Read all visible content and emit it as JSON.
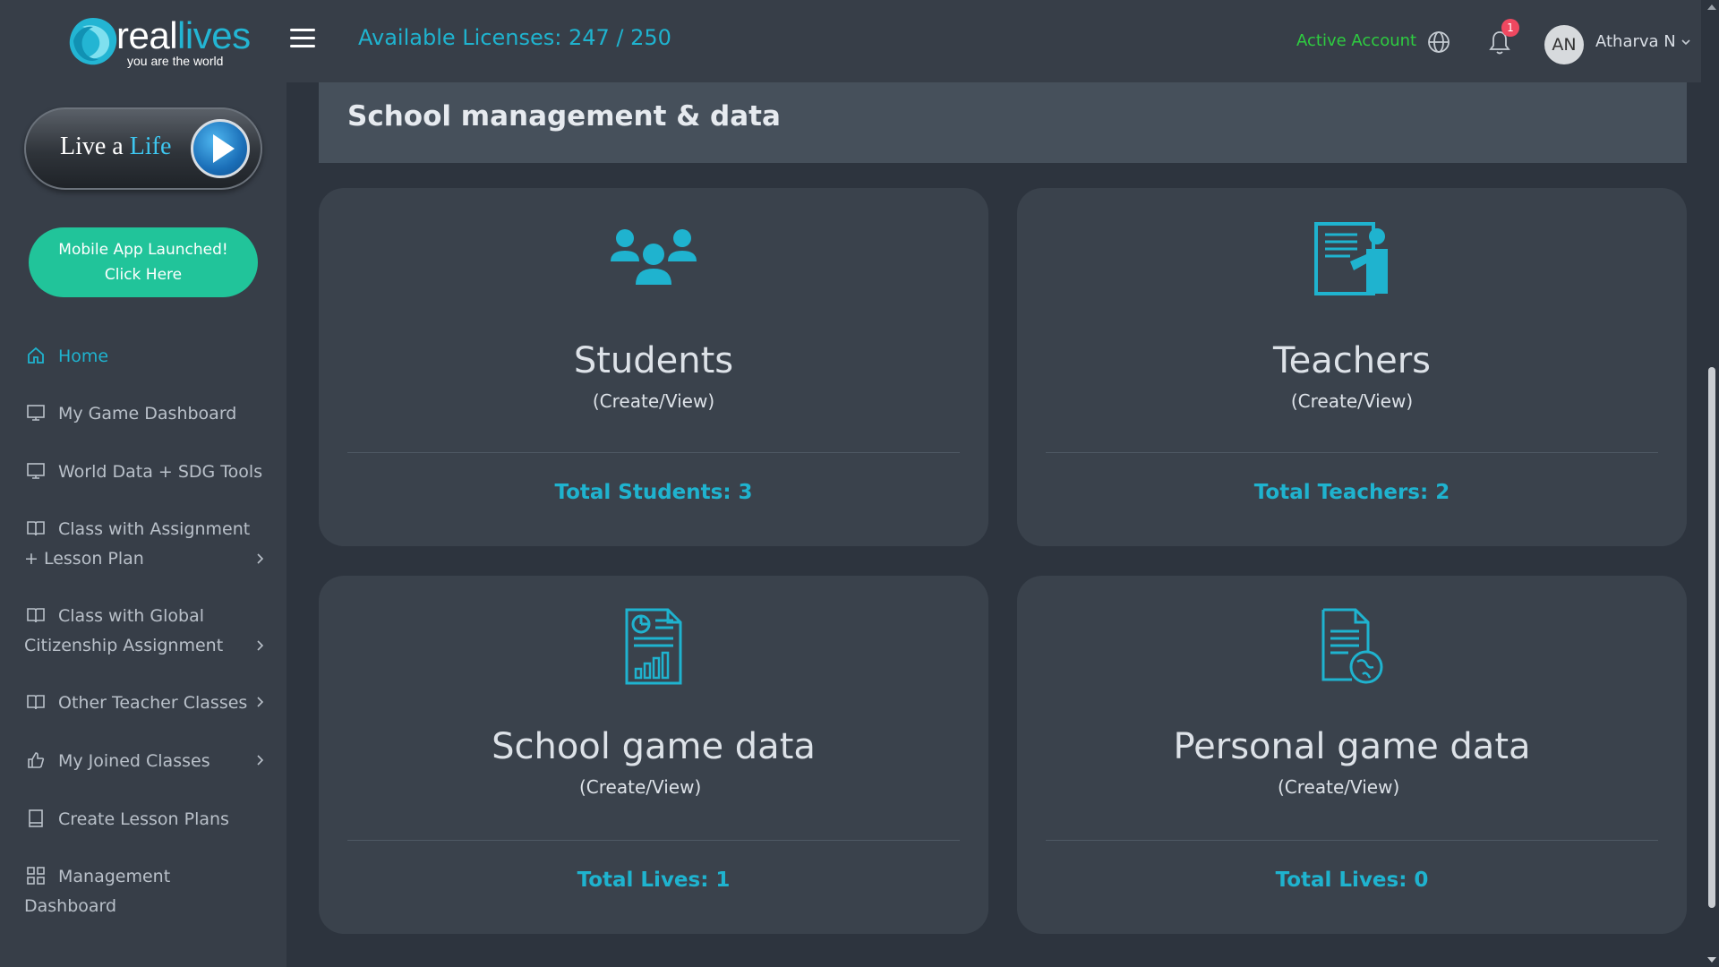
{
  "brand": {
    "name_prefix": "real",
    "name_accent": "lives",
    "tagline": "you are the world",
    "logo_icon": "reallives-logo-icon"
  },
  "sidebar": {
    "live_button": {
      "prefix": "Live a ",
      "accent": "Life",
      "icon": "play-icon"
    },
    "mobile_button": {
      "line1": "Mobile App Launched!",
      "line2": "Click Here"
    },
    "items": [
      {
        "label": "Home",
        "icon": "home-icon",
        "active": true
      },
      {
        "label": "My Game Dashboard",
        "icon": "monitor-icon"
      },
      {
        "label": "World Data + SDG Tools",
        "icon": "monitor-icon"
      },
      {
        "label_line1": "Class with Assignment",
        "label_line2": "+ Lesson Plan",
        "icon": "book-icon",
        "expandable": true
      },
      {
        "label_line1": "Class with Global",
        "label_line2": "Citizenship Assignment",
        "icon": "book-icon",
        "expandable": true
      },
      {
        "label": "Other Teacher Classes",
        "icon": "book-icon",
        "expandable": true
      },
      {
        "label": "My Joined Classes",
        "icon": "thumbs-up-icon",
        "expandable": true
      },
      {
        "label": "Create Lesson Plans",
        "icon": "notebook-icon"
      },
      {
        "label_line1": "Management",
        "label_line2": "Dashboard",
        "icon": "grid-icon"
      }
    ]
  },
  "topbar": {
    "licenses": "Available Licenses: 247 / 250",
    "account_status": "Active Account",
    "notification_count": "1",
    "avatar_initials": "AN",
    "username": "Atharva N",
    "colors": {
      "license": "#1fb3cf",
      "active": "#2ecc40",
      "badge": "#ef4860"
    }
  },
  "main": {
    "section_title": "School management & data",
    "cards": [
      {
        "title": "Students",
        "subtitle": "(Create/View)",
        "total": "Total Students: 3",
        "icon": "users-group-icon"
      },
      {
        "title": "Teachers",
        "subtitle": "(Create/View)",
        "total": "Total Teachers: 2",
        "icon": "teacher-board-icon"
      },
      {
        "title": "School game data",
        "subtitle": "(Create/View)",
        "total": "Total Lives: 1",
        "icon": "report-chart-icon"
      },
      {
        "title": "Personal game data",
        "subtitle": "(Create/View)",
        "total": "Total Lives: 0",
        "icon": "document-globe-icon"
      }
    ]
  },
  "colors": {
    "accent": "#1fb3cf",
    "mobile_button": "#21c49a",
    "card_bg": "#3a424c",
    "page_bg": "#2d343e"
  }
}
